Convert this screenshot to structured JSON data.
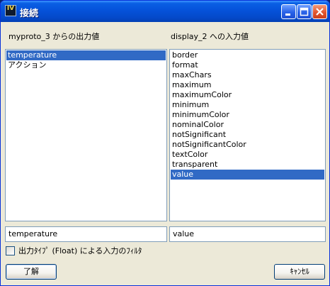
{
  "window": {
    "title": "接続",
    "icon": {
      "name": "iv-app-icon",
      "text": "IV"
    }
  },
  "source": {
    "label": "myproto_3 からの出力値",
    "items": [
      "temperature",
      "アクション"
    ],
    "selected_index": 0,
    "field_value": "temperature"
  },
  "target": {
    "label": "display_2 への入力値",
    "items": [
      "border",
      "format",
      "maxChars",
      "maximum",
      "maximumColor",
      "minimum",
      "minimumColor",
      "nominalColor",
      "notSignificant",
      "notSignificantColor",
      "textColor",
      "transparent",
      "value"
    ],
    "selected_index": 12,
    "field_value": "value"
  },
  "filter": {
    "label": "出力ﾀｲﾌﾟ (Float) による入力のﾌｨﾙﾀ",
    "checked": false
  },
  "buttons": {
    "ok": "了解",
    "cancel": "ｷｬﾝｾﾙ"
  },
  "colors": {
    "selection": "#316AC5",
    "titlebar": "#0552DA"
  }
}
